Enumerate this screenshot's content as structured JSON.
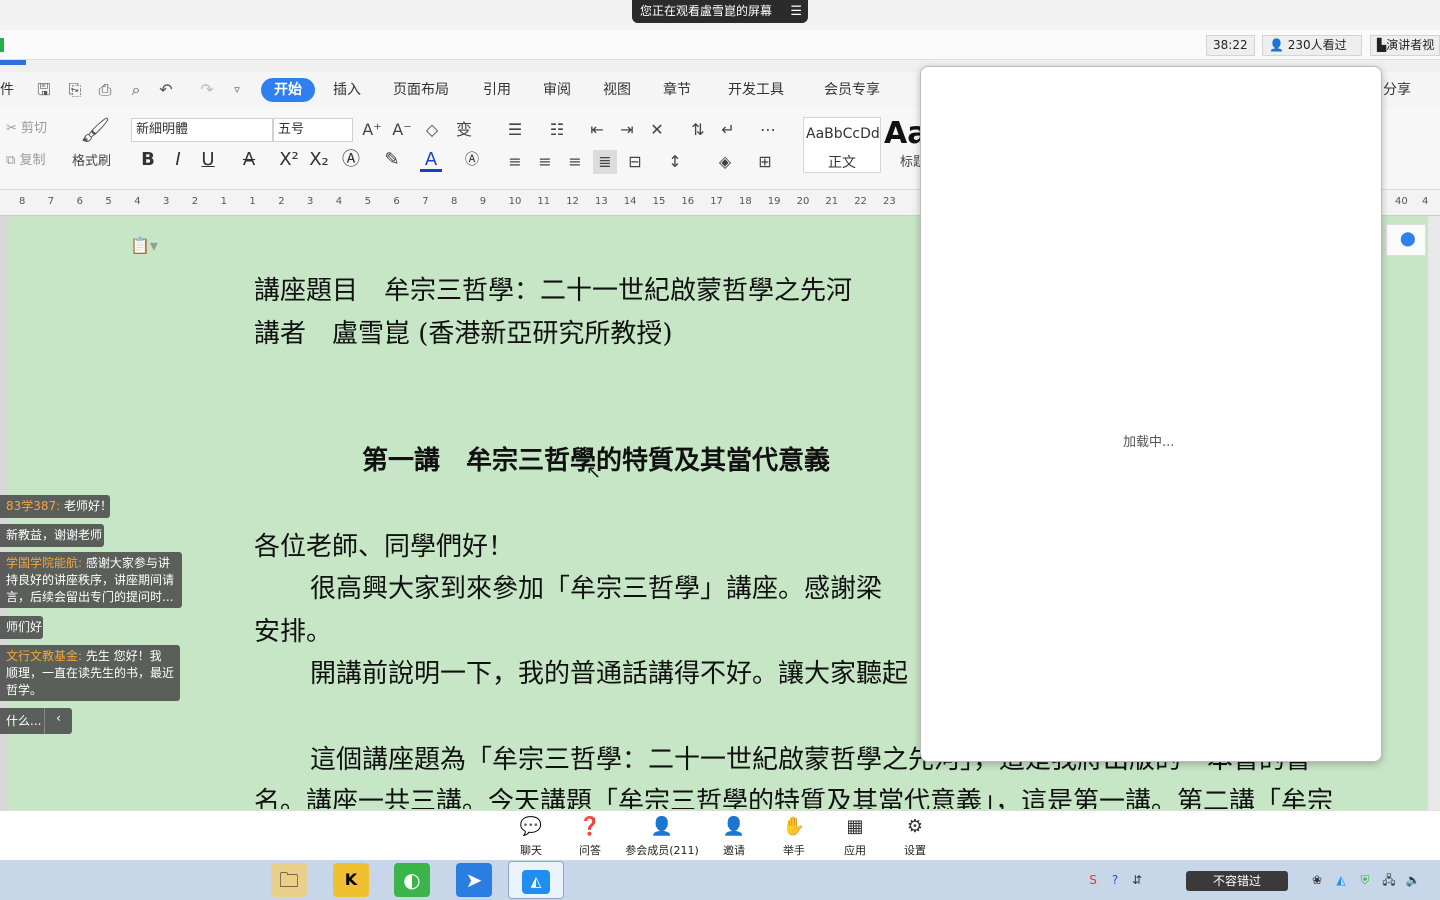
{
  "share_banner": {
    "text": "您正在观看盧雪崑的屏幕",
    "menu_icon": "menu-lines-icon"
  },
  "status_bar": {
    "timer": "38:22",
    "viewers": "230人看过",
    "presenter_view": "演讲者视"
  },
  "ribbon_tabs": {
    "file_partial": "件",
    "start": "开始",
    "insert": "插入",
    "page_layout": "页面布局",
    "references": "引用",
    "review": "审阅",
    "view": "视图",
    "chapter": "章节",
    "dev_tools": "开发工具",
    "member": "会员专享",
    "share": "分享"
  },
  "ribbon": {
    "cut": "剪切",
    "copy": "复制",
    "format_painter": "格式刷",
    "font_name": "新細明體",
    "font_size": "五号",
    "style_preview": "AaBbCcDd",
    "style_normal": "正文",
    "style_heading_preview": "Aa",
    "style_heading": "标题"
  },
  "ruler": {
    "ticks": [
      "8",
      "7",
      "6",
      "5",
      "4",
      "3",
      "2",
      "1",
      "1",
      "2",
      "3",
      "4",
      "5",
      "6",
      "7",
      "8",
      "9",
      "10",
      "11",
      "12",
      "13",
      "14",
      "15",
      "16",
      "17",
      "18",
      "19",
      "20",
      "21",
      "22",
      "23",
      "40",
      "4"
    ]
  },
  "document": {
    "line1": "講座題目　牟宗三哲學：二十一世紀啟蒙哲學之先河",
    "line2": "講者　盧雪崑 (香港新亞研究所教授)",
    "heading": "第一講　牟宗三哲學的特質及其當代意義",
    "greeting": "各位老師、同學們好！",
    "p1a": "很高興大家到來參加「牟宗三哲學」講座。感謝梁",
    "p1b": "安排。",
    "p2": "開講前說明一下，我的普通話講得不好。讓大家聽起",
    "p3a": "這個講座題為「牟宗三哲學：二十一世紀啟蒙哲學之先河」，這是我將出版的一本書的書",
    "p3b": "名。講座一共三講。今天講題「牟宗三哲學的特質及其當代意義」，這是第一講。第二講「牟宗"
  },
  "overlay": {
    "loading": "加载中..."
  },
  "chat": [
    {
      "name": "83学387:",
      "text": " 老师好！"
    },
    {
      "name": "",
      "text": "新教益，谢谢老师"
    },
    {
      "name": "学国学院能航:",
      "text": " 感谢大家参与讲",
      "line2": "持良好的讲座秩序，讲座期间请",
      "line3": "言，后续会留出专门的提问时..."
    },
    {
      "name": "",
      "text": "师们好"
    },
    {
      "name": "文行文教基金:",
      "text": " 先生 您好！我",
      "line2": "顺理，一直在读先生的书，最近",
      "line3": "哲学。"
    },
    {
      "name": "",
      "text": "什么..."
    }
  ],
  "meeting_bar": {
    "chat": "聊天",
    "qa": "问答",
    "participants": "参会成员(211)",
    "invite": "邀请",
    "raise_hand": "举手",
    "apps": "应用",
    "settings": "设置"
  },
  "taskbar": {
    "tray_text": "不容错过"
  },
  "colors": {
    "accent": "#2f80ed",
    "page_green": "#c7e6c6",
    "taskbar": "#c7d6e8"
  }
}
